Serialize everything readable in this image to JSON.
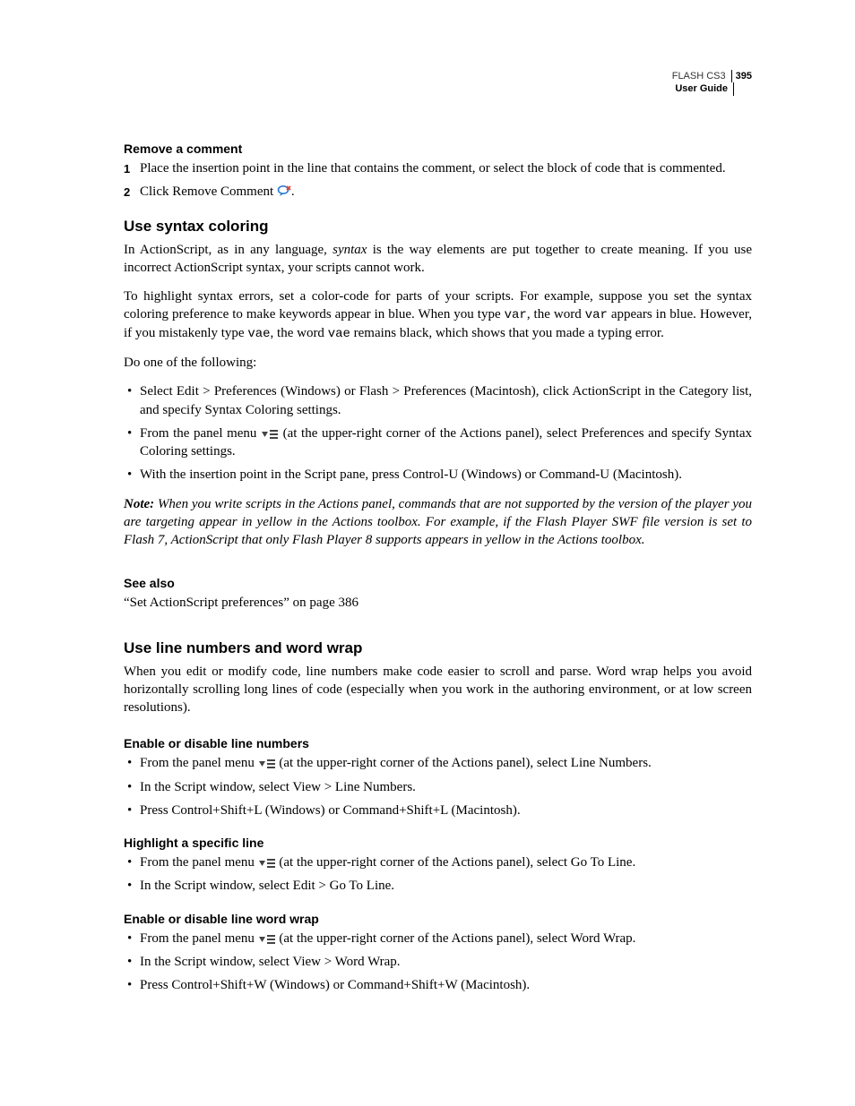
{
  "header": {
    "product": "FLASH CS3",
    "pageNumber": "395",
    "guide": "User Guide"
  },
  "removeComment": {
    "heading": "Remove a comment",
    "step1": "Place the insertion point in the line that contains the comment, or select the block of code that is commented.",
    "step2a": "Click Remove Comment ",
    "step2b": "."
  },
  "syntaxColoring": {
    "heading": "Use syntax coloring",
    "p1a": "In ActionScript, as in any language, ",
    "p1b": "syntax",
    "p1c": " is the way elements are put together to create meaning. If you use incorrect ActionScript syntax, your scripts cannot work.",
    "p2a": "To highlight syntax errors, set a color-code for parts of your scripts. For example, suppose you set the syntax coloring preference to make keywords appear in blue. When you type ",
    "p2b": "var",
    "p2c": ", the word ",
    "p2d": "var",
    "p2e": " appears in blue. However, if you mistakenly type ",
    "p2f": "vae",
    "p2g": ", the word ",
    "p2h": "vae",
    "p2i": " remains black, which shows that you made a typing error.",
    "p3": "Do one of the following:",
    "b1": "Select Edit > Preferences (Windows) or Flash > Preferences (Macintosh), click ActionScript in the Category list, and specify Syntax Coloring settings.",
    "b2a": "From the panel menu ",
    "b2b": " (at the upper-right corner of the Actions panel), select Preferences and specify Syntax Coloring settings.",
    "b3": "With the insertion point in the Script pane, press Control-U (Windows) or Command-U (Macintosh).",
    "noteLabel": "Note:",
    "noteBody": " When you write scripts in the Actions panel, commands that are not supported by the version of the player you are targeting appear in yellow in the Actions toolbox. For example, if the Flash Player SWF file version is set to Flash 7, ActionScript that only Flash Player 8 supports appears in yellow in the Actions toolbox."
  },
  "seeAlso": {
    "heading": "See also",
    "link": "“Set ActionScript preferences” on page 386"
  },
  "lineNumbers": {
    "heading": "Use line numbers and word wrap",
    "p1": "When you edit or modify code, line numbers make code easier to scroll and parse. Word wrap helps you avoid horizontally scrolling long lines of code (especially when you work in the authoring environment, or at low screen resolutions).",
    "enableHeading": "Enable or disable line numbers",
    "enableB1a": "From the panel menu ",
    "enableB1b": " (at the upper-right corner of the Actions panel), select Line Numbers.",
    "enableB2": "In the Script window, select View > Line Numbers.",
    "enableB3": "Press Control+Shift+L (Windows) or Command+Shift+L (Macintosh).",
    "highlightHeading": "Highlight a specific line",
    "highlightB1a": "From the panel menu ",
    "highlightB1b": " (at the upper-right corner of the Actions panel), select Go To Line.",
    "highlightB2": "In the Script window, select Edit > Go To Line.",
    "wrapHeading": "Enable or disable line word wrap",
    "wrapB1a": "From the panel menu ",
    "wrapB1b": " (at the upper-right corner of the Actions panel), select Word Wrap.",
    "wrapB2": "In the Script window, select View > Word Wrap.",
    "wrapB3": "Press Control+Shift+W (Windows) or Command+Shift+W (Macintosh)."
  }
}
